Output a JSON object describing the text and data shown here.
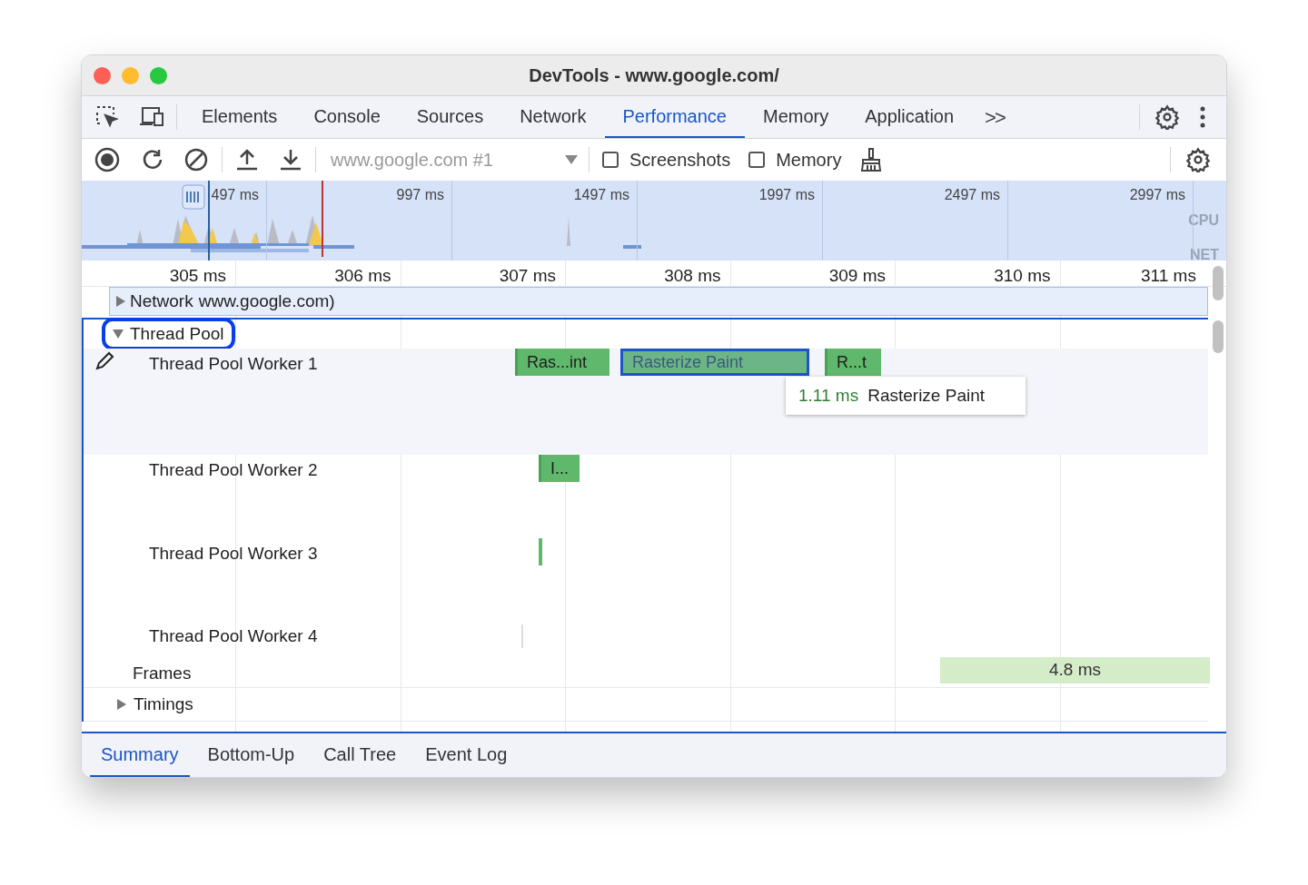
{
  "window": {
    "title": "DevTools - www.google.com/"
  },
  "tabs": [
    {
      "label": "Elements",
      "selected": false
    },
    {
      "label": "Console",
      "selected": false
    },
    {
      "label": "Sources",
      "selected": false
    },
    {
      "label": "Network",
      "selected": false
    },
    {
      "label": "Performance",
      "selected": true
    },
    {
      "label": "Memory",
      "selected": false
    },
    {
      "label": "Application",
      "selected": false
    }
  ],
  "more_tabs": ">>",
  "toolbar": {
    "target": "www.google.com #1",
    "checkboxes": [
      {
        "label": "Screenshots",
        "checked": false
      },
      {
        "label": "Memory",
        "checked": false
      }
    ]
  },
  "overview": {
    "ticks": [
      "497 ms",
      "997 ms",
      "1497 ms",
      "1997 ms",
      "2497 ms",
      "2997 ms"
    ],
    "cpu_label": "CPU",
    "net_label": "NET"
  },
  "ruler": [
    "305 ms",
    "306 ms",
    "307 ms",
    "308 ms",
    "309 ms",
    "310 ms",
    "311 ms"
  ],
  "network_track": {
    "label": "Network",
    "detail": "www.google.com)",
    "expanded": false
  },
  "thread_pool": {
    "label": "Thread Pool",
    "expanded": true,
    "highlighted": true,
    "workers": [
      {
        "label": "Thread Pool Worker 1",
        "events": [
          {
            "label": "Ras...int",
            "selected": false
          },
          {
            "label": "Rasterize Paint",
            "selected": true
          },
          {
            "label": "R...t",
            "selected": false
          }
        ]
      },
      {
        "label": "Thread Pool Worker 2",
        "events": [
          {
            "label": "I...",
            "selected": false
          }
        ]
      },
      {
        "label": "Thread Pool Worker 3",
        "events": [
          {
            "selected": false
          }
        ]
      },
      {
        "label": "Thread Pool Worker 4"
      }
    ]
  },
  "tooltip": {
    "duration": "1.11 ms",
    "name": "Rasterize Paint"
  },
  "frames": {
    "label": "Frames",
    "value": "4.8 ms"
  },
  "timings": {
    "label": "Timings",
    "expanded": false
  },
  "bottom_tabs": [
    {
      "label": "Summary",
      "selected": true
    },
    {
      "label": "Bottom-Up",
      "selected": false
    },
    {
      "label": "Call Tree",
      "selected": false
    },
    {
      "label": "Event Log",
      "selected": false
    }
  ]
}
